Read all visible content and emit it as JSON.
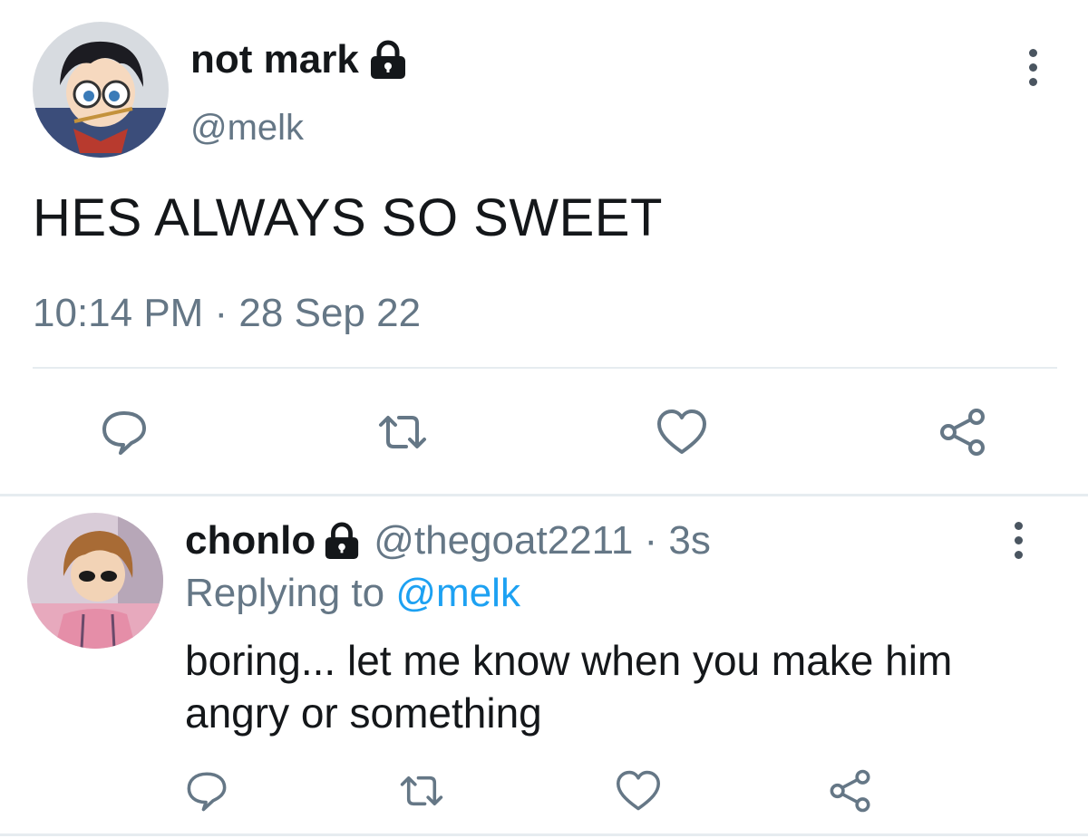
{
  "main_tweet": {
    "display_name": "not mark",
    "handle": "@melk",
    "text": "HES ALWAYS SO SWEET",
    "timestamp": "10:14 PM · 28 Sep 22",
    "locked": true
  },
  "reply": {
    "display_name": "chonlo",
    "meta": "@thegoat2211 · 3s",
    "replying_prefix": "Replying to",
    "replying_mention": "@melk",
    "text": "boring... let me know when you make him angry or something",
    "locked": true
  },
  "icons": {
    "reply": "speech-bubble-icon",
    "retweet": "retweet-icon",
    "like": "heart-icon",
    "share": "share-icon",
    "more": "vertical-dots-icon",
    "protected": "lock-icon"
  },
  "colors": {
    "text": "#14171a",
    "secondary": "#657786",
    "link": "#1da1f2",
    "divider": "#e6ecf0"
  }
}
